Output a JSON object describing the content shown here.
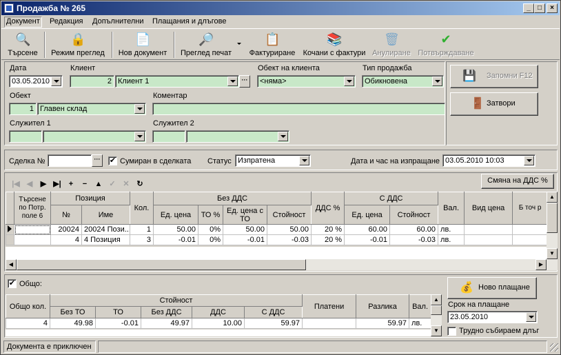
{
  "window": {
    "title": "Продажба № 265",
    "min": "_",
    "max": "□",
    "close": "×"
  },
  "menu": [
    "Документ",
    "Редакция",
    "Допълнителни",
    "Плащания и длъгове"
  ],
  "toolbar": [
    {
      "label": "Търсене",
      "icon": "search-icon",
      "glyph": "🔍",
      "disabled": false
    },
    {
      "label": "Режим преглед",
      "icon": "lock-icon",
      "glyph": "🔒",
      "disabled": false
    },
    {
      "label": "Нов документ",
      "icon": "new-document-icon",
      "glyph": "📄",
      "disabled": false
    },
    {
      "label": "Преглед печат",
      "icon": "print-preview-icon",
      "glyph": "🔎",
      "disabled": false
    },
    {
      "label": "Фактуриране",
      "icon": "invoice-icon",
      "glyph": "📋",
      "disabled": false
    },
    {
      "label": "Кочани с фактури",
      "icon": "invoice-books-icon",
      "glyph": "📚",
      "disabled": false
    },
    {
      "label": "Анулиране",
      "icon": "cancel-bin-icon",
      "glyph": "🗑",
      "disabled": true
    },
    {
      "label": "Потвърждаване",
      "icon": "confirm-check-icon",
      "glyph": "✔",
      "disabled": true
    }
  ],
  "form": {
    "date_label": "Дата",
    "date_value": "03.05.2010",
    "client_label": "Клиент",
    "client_code": "2",
    "client_name": "Клиент 1",
    "client_object_label": "Обект на клиента",
    "client_object_value": "<няма>",
    "sale_type_label": "Тип продажба",
    "sale_type_value": "Обикновена",
    "object_label": "Обект",
    "object_code": "1",
    "object_name": "Главен склад",
    "comment_label": "Коментар",
    "comment_value": "",
    "employee1_label": "Служител 1",
    "employee2_label": "Служител 2",
    "save_label": "Запомни  F12",
    "close_label": "Затвори"
  },
  "deal": {
    "deal_label": "Сделка №",
    "deal_value": "",
    "summed_label": "Сумиран в сделката",
    "summed_checked": true,
    "status_label": "Статус",
    "status_value": "Изпратена",
    "send_label": "Дата и час на изпращане",
    "send_value": "03.05.2010 10:03"
  },
  "nav": {
    "buttons": [
      "|◀",
      "◀",
      "▶",
      "▶|",
      "+",
      "−",
      "▲",
      "✓",
      "✕",
      "↻"
    ],
    "vat_change_label": "Смяна на ДДС %"
  },
  "items_table": {
    "headers": {
      "search": "Търсене по Потр. поле 6",
      "position": "Позиция",
      "pos_no": "№",
      "pos_name": "Име",
      "qty": "Кол.",
      "no_vat": "Без ДДС",
      "unit_price": "Ед. цена",
      "to_pct": "ТО %",
      "unit_price_to": "Ед. цена с ТО",
      "value": "Стойност",
      "vat_pct": "ДДС %",
      "with_vat": "С ДДС",
      "unit_price_vat": "Ед. цена",
      "value_vat": "Стойност",
      "currency": "Вал.",
      "price_type": "Вид цена",
      "extra": "Б точ р"
    },
    "rows": [
      {
        "search": "",
        "no": "20024",
        "name": "20024 Пози...",
        "qty": "1",
        "unit_price": "50.00",
        "to": "0%",
        "unit_to": "50.00",
        "value": "50.00",
        "vat": "20 %",
        "unit_vat": "60.00",
        "value_vat": "60.00",
        "cur": "лв.",
        "ptype": ""
      },
      {
        "search": "",
        "no": "4",
        "name": "4 Позиция",
        "qty": "3",
        "unit_price": "-0.01",
        "to": "0%",
        "unit_to": "-0.01",
        "value": "-0.03",
        "vat": "20 %",
        "unit_vat": "-0.01",
        "value_vat": "-0.03",
        "cur": "лв.",
        "ptype": ""
      }
    ]
  },
  "totals": {
    "total_label": "Общо:",
    "total_checked": true,
    "new_payment_label": "Ново плащане",
    "headers": {
      "qty": "Общо кол.",
      "value": "Стойност",
      "no_to": "Без ТО",
      "to": "ТО",
      "no_vat": "Без ДДС",
      "vat": "ДДС",
      "with_vat": "С ДДС",
      "paid": "Платени",
      "diff": "Разлика",
      "cur": "Вал."
    },
    "row": {
      "qty": "4",
      "no_to": "49.98",
      "to": "-0.01",
      "no_vat": "49.97",
      "vat": "10.00",
      "with_vat": "59.97",
      "paid": "",
      "diff": "59.97",
      "cur": "лв."
    },
    "due_label": "Срок на плащане",
    "due_value": "23.05.2010",
    "hard_debt_label": "Трудно събираем длъг",
    "hard_debt_checked": false
  },
  "status": {
    "text": "Документа е приключен",
    "panel2": ""
  }
}
